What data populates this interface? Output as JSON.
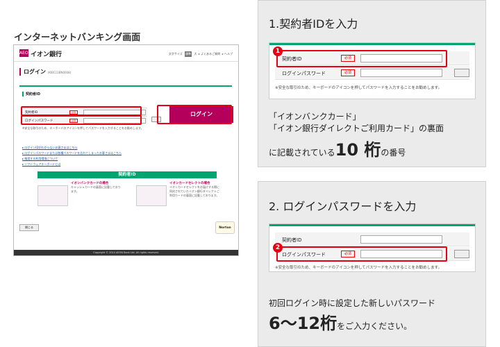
{
  "left": {
    "title": "インターネットバンキング画面",
    "logo_mark": "AEON",
    "logo_text": "イオン銀行",
    "header_links": {
      "font_size_label": "文字サイズ",
      "size_small": "標準",
      "size_large": "大",
      "faq": "▸ よくあるご質問",
      "help": "▸ ヘルプ"
    },
    "page_title": "ログイン",
    "page_code": "(KIBC11BN0008)",
    "section_title": "契約者ID",
    "contract_id_label": "契約者ID",
    "password_label": "ログインパスワード",
    "required": "必須",
    "login_button": "ログイン",
    "note": "※安全な取引のため、キーボードのアイコンを押してパスワードを入力することをお勧めします。",
    "links": [
      "▸ ログインIDがわからないお客さまはこちら",
      "▸ ログインパスワードまたは各種パスワードを忘れてしまったお客さまはこちら",
      "▸ 推奨する利用環境について",
      "▸ ソフトウェアキーボードとは"
    ],
    "id_header": "契約者ID",
    "card_aeon_title": "イオンバンクカードの場合",
    "card_aeon_desc": "キャッシュカードの裏面に記載しております。",
    "card_select_title": "イオンカードセレクトの場合",
    "card_select_desc": "イオンカードセレクトをお届けする際に同封されていたイオン銀行ダイレクトご利用カードの裏面に記載しております。",
    "close_button": "閉じる",
    "norton": "Norton",
    "footer": "Copyright © 2014 AEON Bank Ltd. All rights reserved."
  },
  "step1": {
    "title": "1.契約者IDを入力",
    "badge": "1",
    "field_label": "契約者ID",
    "pw_label": "ログインパスワード",
    "required": "必須",
    "note": "※安全な取引のため、キーボードのアイコンを押してパスワードを入力することをお勧めします。",
    "line1": "「イオンバンクカード」",
    "line2": "「イオン銀行ダイレクトご利用カード」の裏面",
    "line3_pre": "に記載されている",
    "line3_big": "10 桁",
    "line3_post": "の番号"
  },
  "step2": {
    "title": "2. ログインパスワードを入力",
    "badge": "2",
    "field_label": "契約者ID",
    "pw_label": "ログインパスワード",
    "required": "必須",
    "note": "※安全な取引のため、キーボードのアイコンを押してパスワードを入力することをお勧めします。",
    "line1": "初回ログイン時に設定した新しいパスワード",
    "line2_big": "6〜12桁",
    "line2_post": "をご入力ください。"
  },
  "colors": {
    "brand": "#b4005a",
    "accent_green": "#00a46e",
    "highlight": "#e60012"
  }
}
